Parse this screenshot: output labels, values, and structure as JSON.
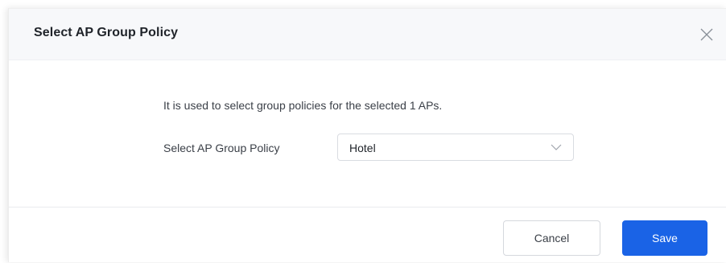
{
  "dialog": {
    "title": "Select AP Group Policy",
    "close_icon": "close-icon"
  },
  "body": {
    "description": "It is used to select group policies for the selected 1 APs.",
    "field_label": "Select AP Group Policy",
    "select": {
      "value": "Hotel",
      "arrow_icon": "chevron-down-icon"
    }
  },
  "footer": {
    "cancel_label": "Cancel",
    "save_label": "Save"
  },
  "colors": {
    "primary": "#1a63e6",
    "header_bg": "#f7f8fa",
    "text": "#3a3f47"
  }
}
